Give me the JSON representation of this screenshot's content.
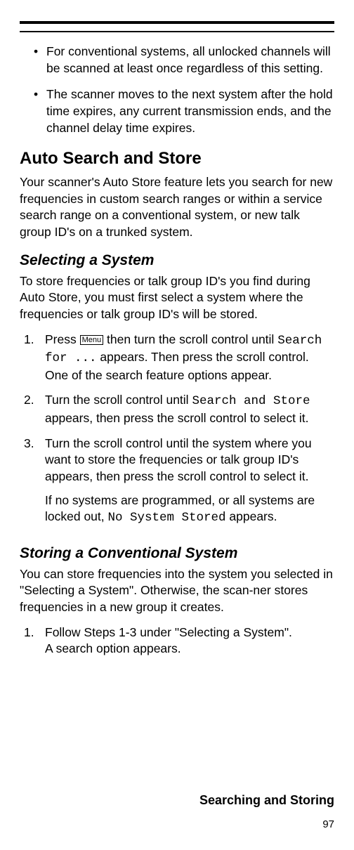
{
  "bullets": [
    "For conventional systems, all unlocked channels will be scanned at least once regardless of this setting.",
    "The scanner moves to the next system after the hold time expires, any current transmission ends, and the channel delay time expires."
  ],
  "section1": {
    "heading": "Auto Search and Store",
    "intro": "Your scanner's Auto Store feature lets you search for new frequencies in custom search ranges or within a service search range on a conventional system, or new talk group ID's on a trunked system."
  },
  "sub1": {
    "heading": "Selecting a System",
    "intro": "To store frequencies or talk group ID's you find during Auto Store, you must first select a system where the frequencies or talk group ID's will be stored.",
    "step1_a": "Press ",
    "menu_label": "Menu",
    "step1_b": " then turn the scroll control until ",
    "step1_code": "Search for ...",
    "step1_c": " appears. Then press the scroll control. One of the search feature options appear.",
    "step2_a": "Turn the scroll control until ",
    "step2_code": "Search and Store",
    "step2_b": " appears, then press the scroll control to select it.",
    "step3_a": "Turn the scroll control until the system where you want to store the frequencies or talk group ID's appears, then press the scroll control to select it.",
    "step3_b_pre": "If no systems are programmed, or all systems are locked out, ",
    "step3_b_code": "No System Stored",
    "step3_b_post": " appears."
  },
  "sub2": {
    "heading": "Storing a Conventional System",
    "intro_l1": "You can store frequencies into the system you selected in \"Selecting a System\". Otherwise, the scan-ner stores",
    "intro_l2": "frequencies in a new group it creates.",
    "step1_l1": "Follow Steps 1-3 under \"Selecting a System\".",
    "step1_l2": "A search option appears."
  },
  "footer": {
    "title": "Searching and Storing",
    "page": "97"
  }
}
